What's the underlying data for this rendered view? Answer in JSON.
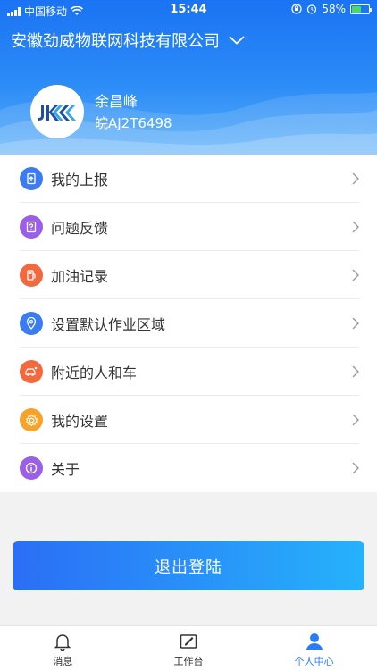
{
  "status_bar": {
    "carrier": "中国移动",
    "time": "15:44",
    "battery": "58%",
    "battery_level": 0.58,
    "icons": [
      "signal-icon",
      "wifi-icon",
      "orientation-lock-icon",
      "alarm-icon",
      "battery-icon"
    ]
  },
  "header": {
    "company": "安徽劲威物联网科技有限公司",
    "user_name": "余昌峰",
    "plate_number": "皖AJ2T6498",
    "avatar_logo_text": "JKKK"
  },
  "menu": {
    "items": [
      {
        "label": "我的上报",
        "icon": "report-icon",
        "color": "#3b7cf0"
      },
      {
        "label": "问题反馈",
        "icon": "feedback-icon",
        "color": "#9a5fe6"
      },
      {
        "label": "加油记录",
        "icon": "fuel-icon",
        "color": "#f2693e"
      },
      {
        "label": "设置默认作业区域",
        "icon": "location-icon",
        "color": "#3b7cf0"
      },
      {
        "label": "附近的人和车",
        "icon": "nearby-icon",
        "color": "#f2693e"
      },
      {
        "label": "我的设置",
        "icon": "settings-icon",
        "color": "#f5a32a"
      },
      {
        "label": "关于",
        "icon": "about-icon",
        "color": "#9a5fe6"
      }
    ]
  },
  "logout_label": "退出登陆",
  "tabs": [
    {
      "label": "消息",
      "icon": "bell-icon"
    },
    {
      "label": "工作台",
      "icon": "workbench-icon"
    },
    {
      "label": "个人中心",
      "icon": "person-icon",
      "active": true
    }
  ],
  "colors": {
    "header_top": "#1a73f3",
    "accent": "#2a7cf6",
    "logout_start": "#2b6ef6",
    "logout_end": "#26b2fb",
    "battery_fill": "#4cd964"
  }
}
